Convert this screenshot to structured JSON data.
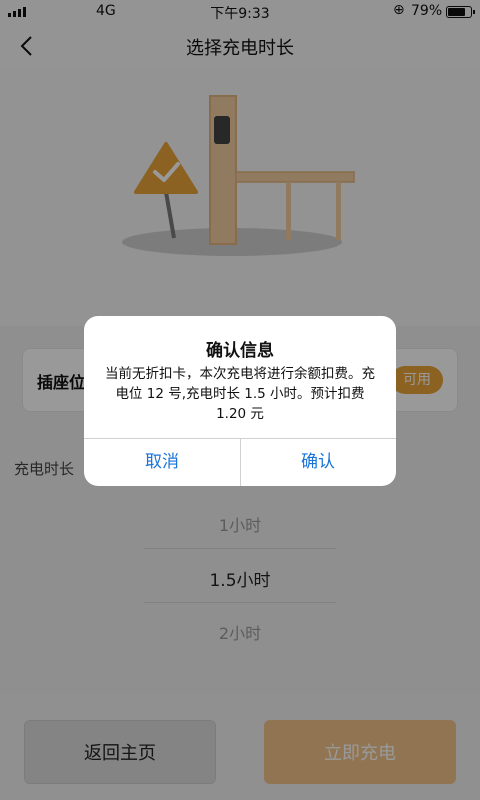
{
  "status_bar": {
    "network": "4G",
    "time": "下午9:33",
    "battery_percent": "79%",
    "battery_level": 0.79
  },
  "nav": {
    "title": "选择充电时长"
  },
  "socket": {
    "label": "插座位",
    "status": "可用"
  },
  "duration": {
    "label": "充电时长",
    "options": [
      "1小时",
      "1.5小时",
      "2小时"
    ],
    "selected": "1.5小时"
  },
  "bottom": {
    "home_label": "返回主页",
    "charge_label": "立即充电"
  },
  "dialog": {
    "title": "确认信息",
    "message": "当前无折扣卡，本次充电将进行余额扣费。充电位 12 号,充电时长 1.5 小时。预计扣费 1.20 元",
    "cancel_label": "取消",
    "confirm_label": "确认"
  },
  "colors": {
    "accent": "#e8a33a",
    "link": "#1a73d9",
    "charge_button": "#f2c48a"
  }
}
